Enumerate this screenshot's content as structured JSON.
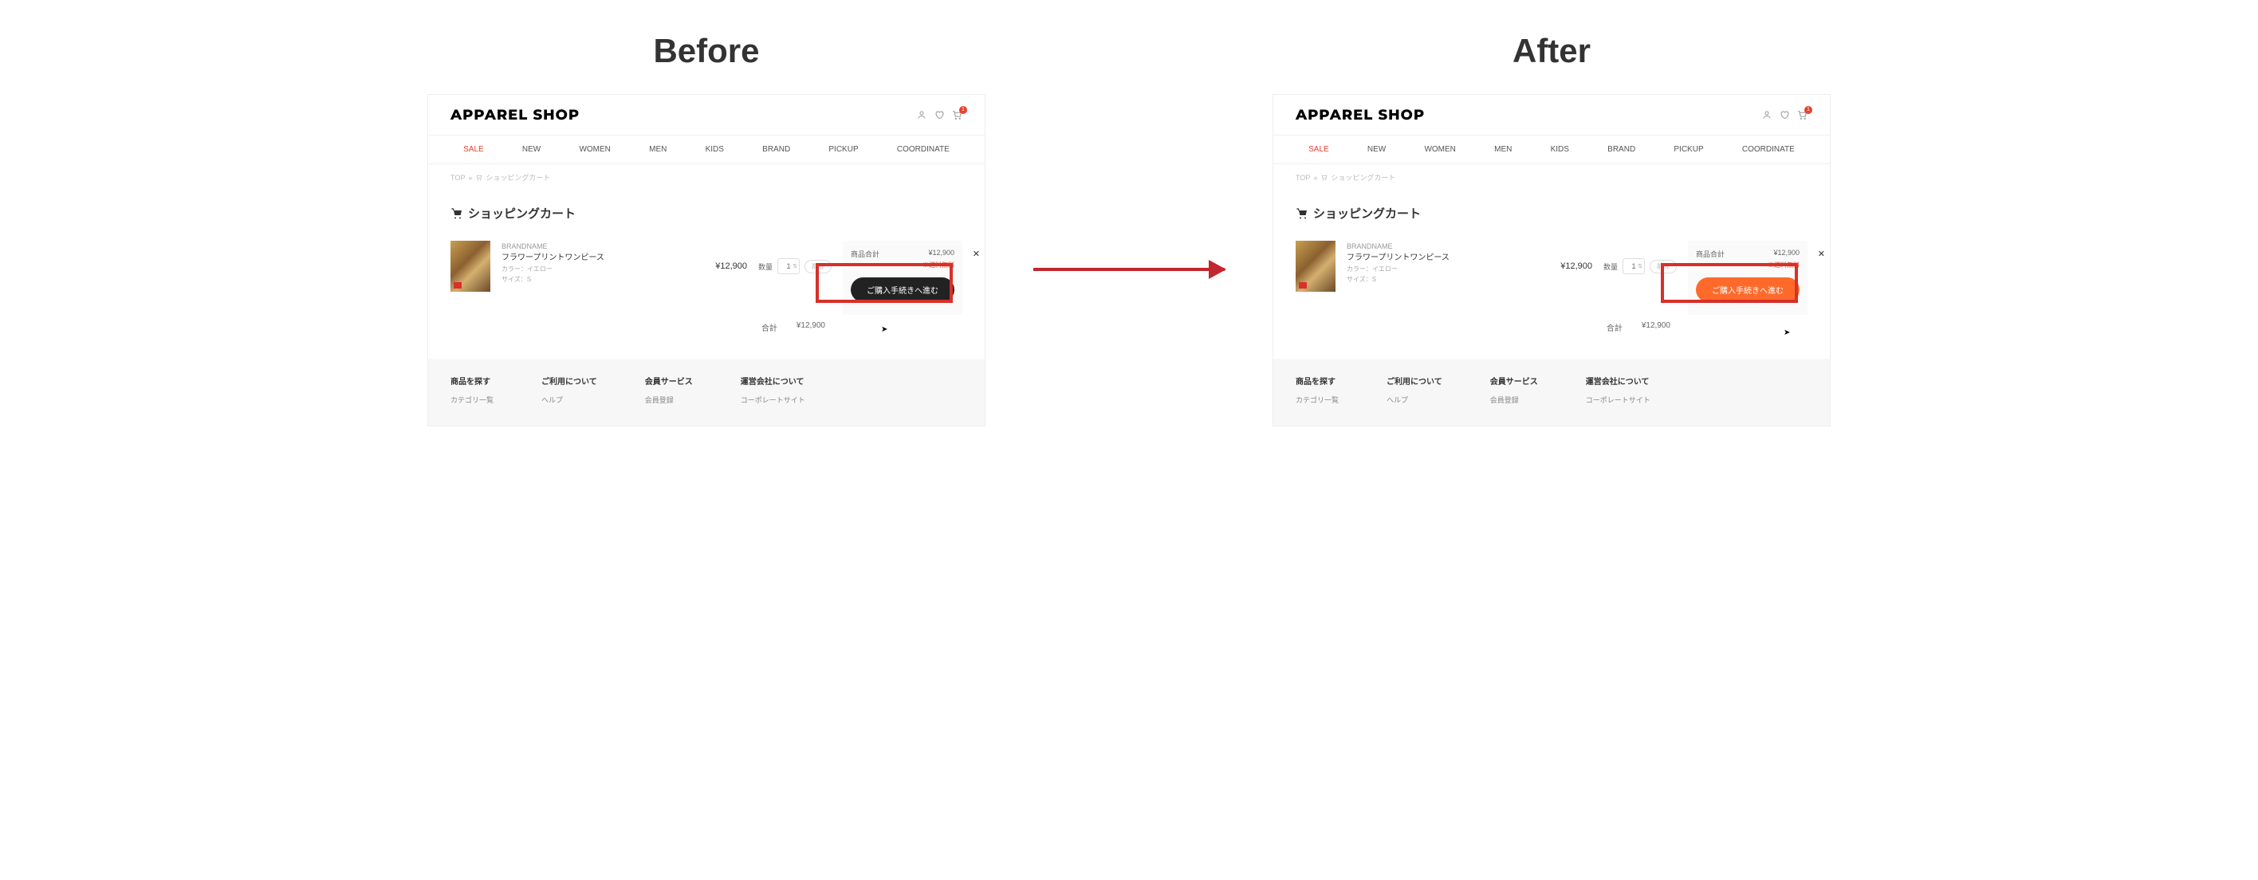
{
  "labels": {
    "before": "Before",
    "after": "After"
  },
  "shop": {
    "logo": "APPAREL SHOP",
    "cart_badge": "1",
    "nav": [
      "SALE",
      "NEW",
      "WOMEN",
      "MEN",
      "KIDS",
      "BRAND",
      "PICKUP",
      "COORDINATE"
    ],
    "breadcrumb": {
      "top": "TOP",
      "sep": "»",
      "current": "ショッピングカート"
    },
    "page_title": "ショッピングカート",
    "item": {
      "brand": "BRANDNAME",
      "name": "フラワープリントワンピース",
      "color": "カラー：イエロー",
      "size": "サイズ：S",
      "price": "¥12,900",
      "qty_label": "数量",
      "qty_value": "1",
      "delete": "削除"
    },
    "summary": {
      "label": "商品合計",
      "value": "¥12,900",
      "free_ship": "※送料無料",
      "checkout": "ご購入手続きへ進む"
    },
    "totals": {
      "label": "合計",
      "value": "¥12,900"
    },
    "footer": [
      {
        "h": "商品を探す",
        "i": "カテゴリ一覧"
      },
      {
        "h": "ご利用について",
        "i": "ヘルプ"
      },
      {
        "h": "会員サービス",
        "i": "会員登録"
      },
      {
        "h": "運営会社について",
        "i": "コーポレートサイト"
      }
    ]
  }
}
